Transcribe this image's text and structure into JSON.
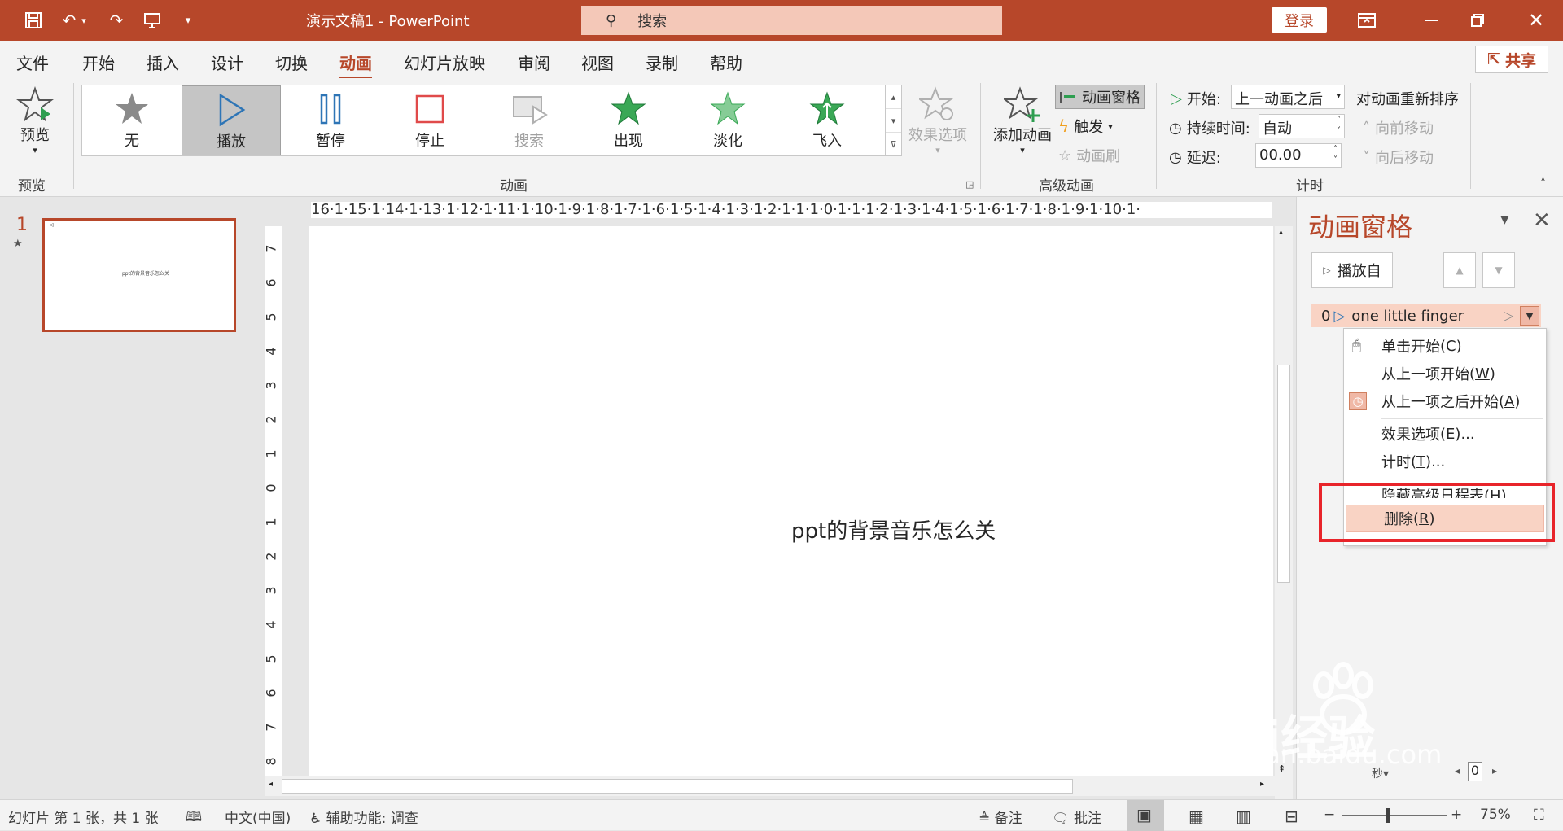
{
  "titlebar": {
    "doc_title": "演示文稿1  -  PowerPoint",
    "search_placeholder": "搜索",
    "login": "登录"
  },
  "menu": {
    "tabs": [
      "文件",
      "开始",
      "插入",
      "设计",
      "切换",
      "动画",
      "幻灯片放映",
      "审阅",
      "视图",
      "录制",
      "帮助"
    ],
    "active": "动画",
    "share": "共享"
  },
  "ribbon": {
    "preview": {
      "label": "预览",
      "group": "预览"
    },
    "gallery": {
      "group": "动画",
      "items": [
        "无",
        "播放",
        "暂停",
        "停止",
        "搜索",
        "出现",
        "淡化",
        "飞入"
      ],
      "selected": "播放"
    },
    "effect_options": "效果选项",
    "advanced": {
      "group": "高级动画",
      "add": "添加动画",
      "pane": "动画窗格",
      "trigger": "触发",
      "painter": "动画刷"
    },
    "timing": {
      "group": "计时",
      "start_label": "开始:",
      "start_value": "上一动画之后",
      "duration_label": "持续时间:",
      "duration_value": "自动",
      "delay_label": "延迟:",
      "delay_value": "00.00",
      "reorder": "对动画重新排序",
      "move_earlier": "向前移动",
      "move_later": "向后移动"
    }
  },
  "slides": {
    "number": "1",
    "thumb_text": "ppt的背景音乐怎么关"
  },
  "ruler": {
    "h": "16·1·15·1·14·1·13·1·12·1·11·1·10·1·9·1·8·1·7·1·6·1·5·1·4·1·3·1·2·1·1·1·0·1·1·1·2·1·3·1·4·1·5·1·6·1·7·1·8·1·9·1·10·1·",
    "v": [
      "7",
      "6",
      "5",
      "4",
      "3",
      "2",
      "1",
      "0",
      "1",
      "2",
      "3",
      "4",
      "5",
      "6",
      "7",
      "8"
    ]
  },
  "slide": {
    "text": "ppt的背景音乐怎么关"
  },
  "anim_pane": {
    "title": "动画窗格",
    "play_from": "播放自",
    "item": {
      "index": "0",
      "name": "one little finger"
    },
    "menu": [
      {
        "label": "单击开始",
        "key": "C"
      },
      {
        "label": "从上一项开始",
        "key": "W"
      },
      {
        "label": "从上一项之后开始",
        "key": "A"
      },
      {
        "label": "效果选项",
        "key": "E",
        "suffix": "..."
      },
      {
        "label": "计时",
        "key": "T",
        "suffix": "..."
      },
      {
        "label": "隐藏高级日程表",
        "key": "H"
      },
      {
        "label": "删除",
        "key": "R"
      }
    ]
  },
  "status": {
    "slide_info": "幻灯片 第 1 张，共 1 张",
    "lang": "中文(中国)",
    "access": "辅助功能: 调查",
    "notes": "备注",
    "comments": "批注",
    "zoom": "75%",
    "mini_value": "0"
  },
  "watermark": {
    "main": "Bai经验",
    "sub": "jingyan.baidu.com"
  },
  "colors": {
    "accent": "#b7472a",
    "highlight": "#f9d3c4",
    "red_box": "#e8242a"
  }
}
